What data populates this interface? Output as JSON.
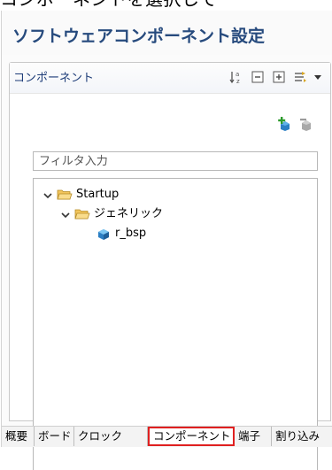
{
  "caption": "コンポーネントを選択して",
  "editor": {
    "title": "ソフトウェアコンポーネント設定"
  },
  "panel": {
    "tab_label": "コンポーネント",
    "tools": [
      "sort-alpha-icon",
      "collapse-all-icon",
      "expand-all-icon",
      "view-menu-icon",
      "dropdown-arrow-icon"
    ],
    "actions": [
      "add-component-icon",
      "remove-component-icon"
    ]
  },
  "filter": {
    "placeholder": "フィルタ入力",
    "value": ""
  },
  "tree": [
    {
      "label": "Startup",
      "level": 0,
      "expanded": true,
      "type": "folder"
    },
    {
      "label": "ジェネリック",
      "level": 1,
      "expanded": true,
      "type": "folder"
    },
    {
      "label": "r_bsp",
      "level": 2,
      "type": "component"
    }
  ],
  "bottom_tabs": [
    {
      "label": "概要"
    },
    {
      "label": "ボード"
    },
    {
      "label": "クロック"
    },
    {
      "label": "コンポーネント",
      "active": true
    },
    {
      "label": "端子"
    },
    {
      "label": "割り込み"
    }
  ],
  "colors": {
    "title": "#264a7d",
    "highlight": "#e02020",
    "folder": "#f2c55c"
  }
}
